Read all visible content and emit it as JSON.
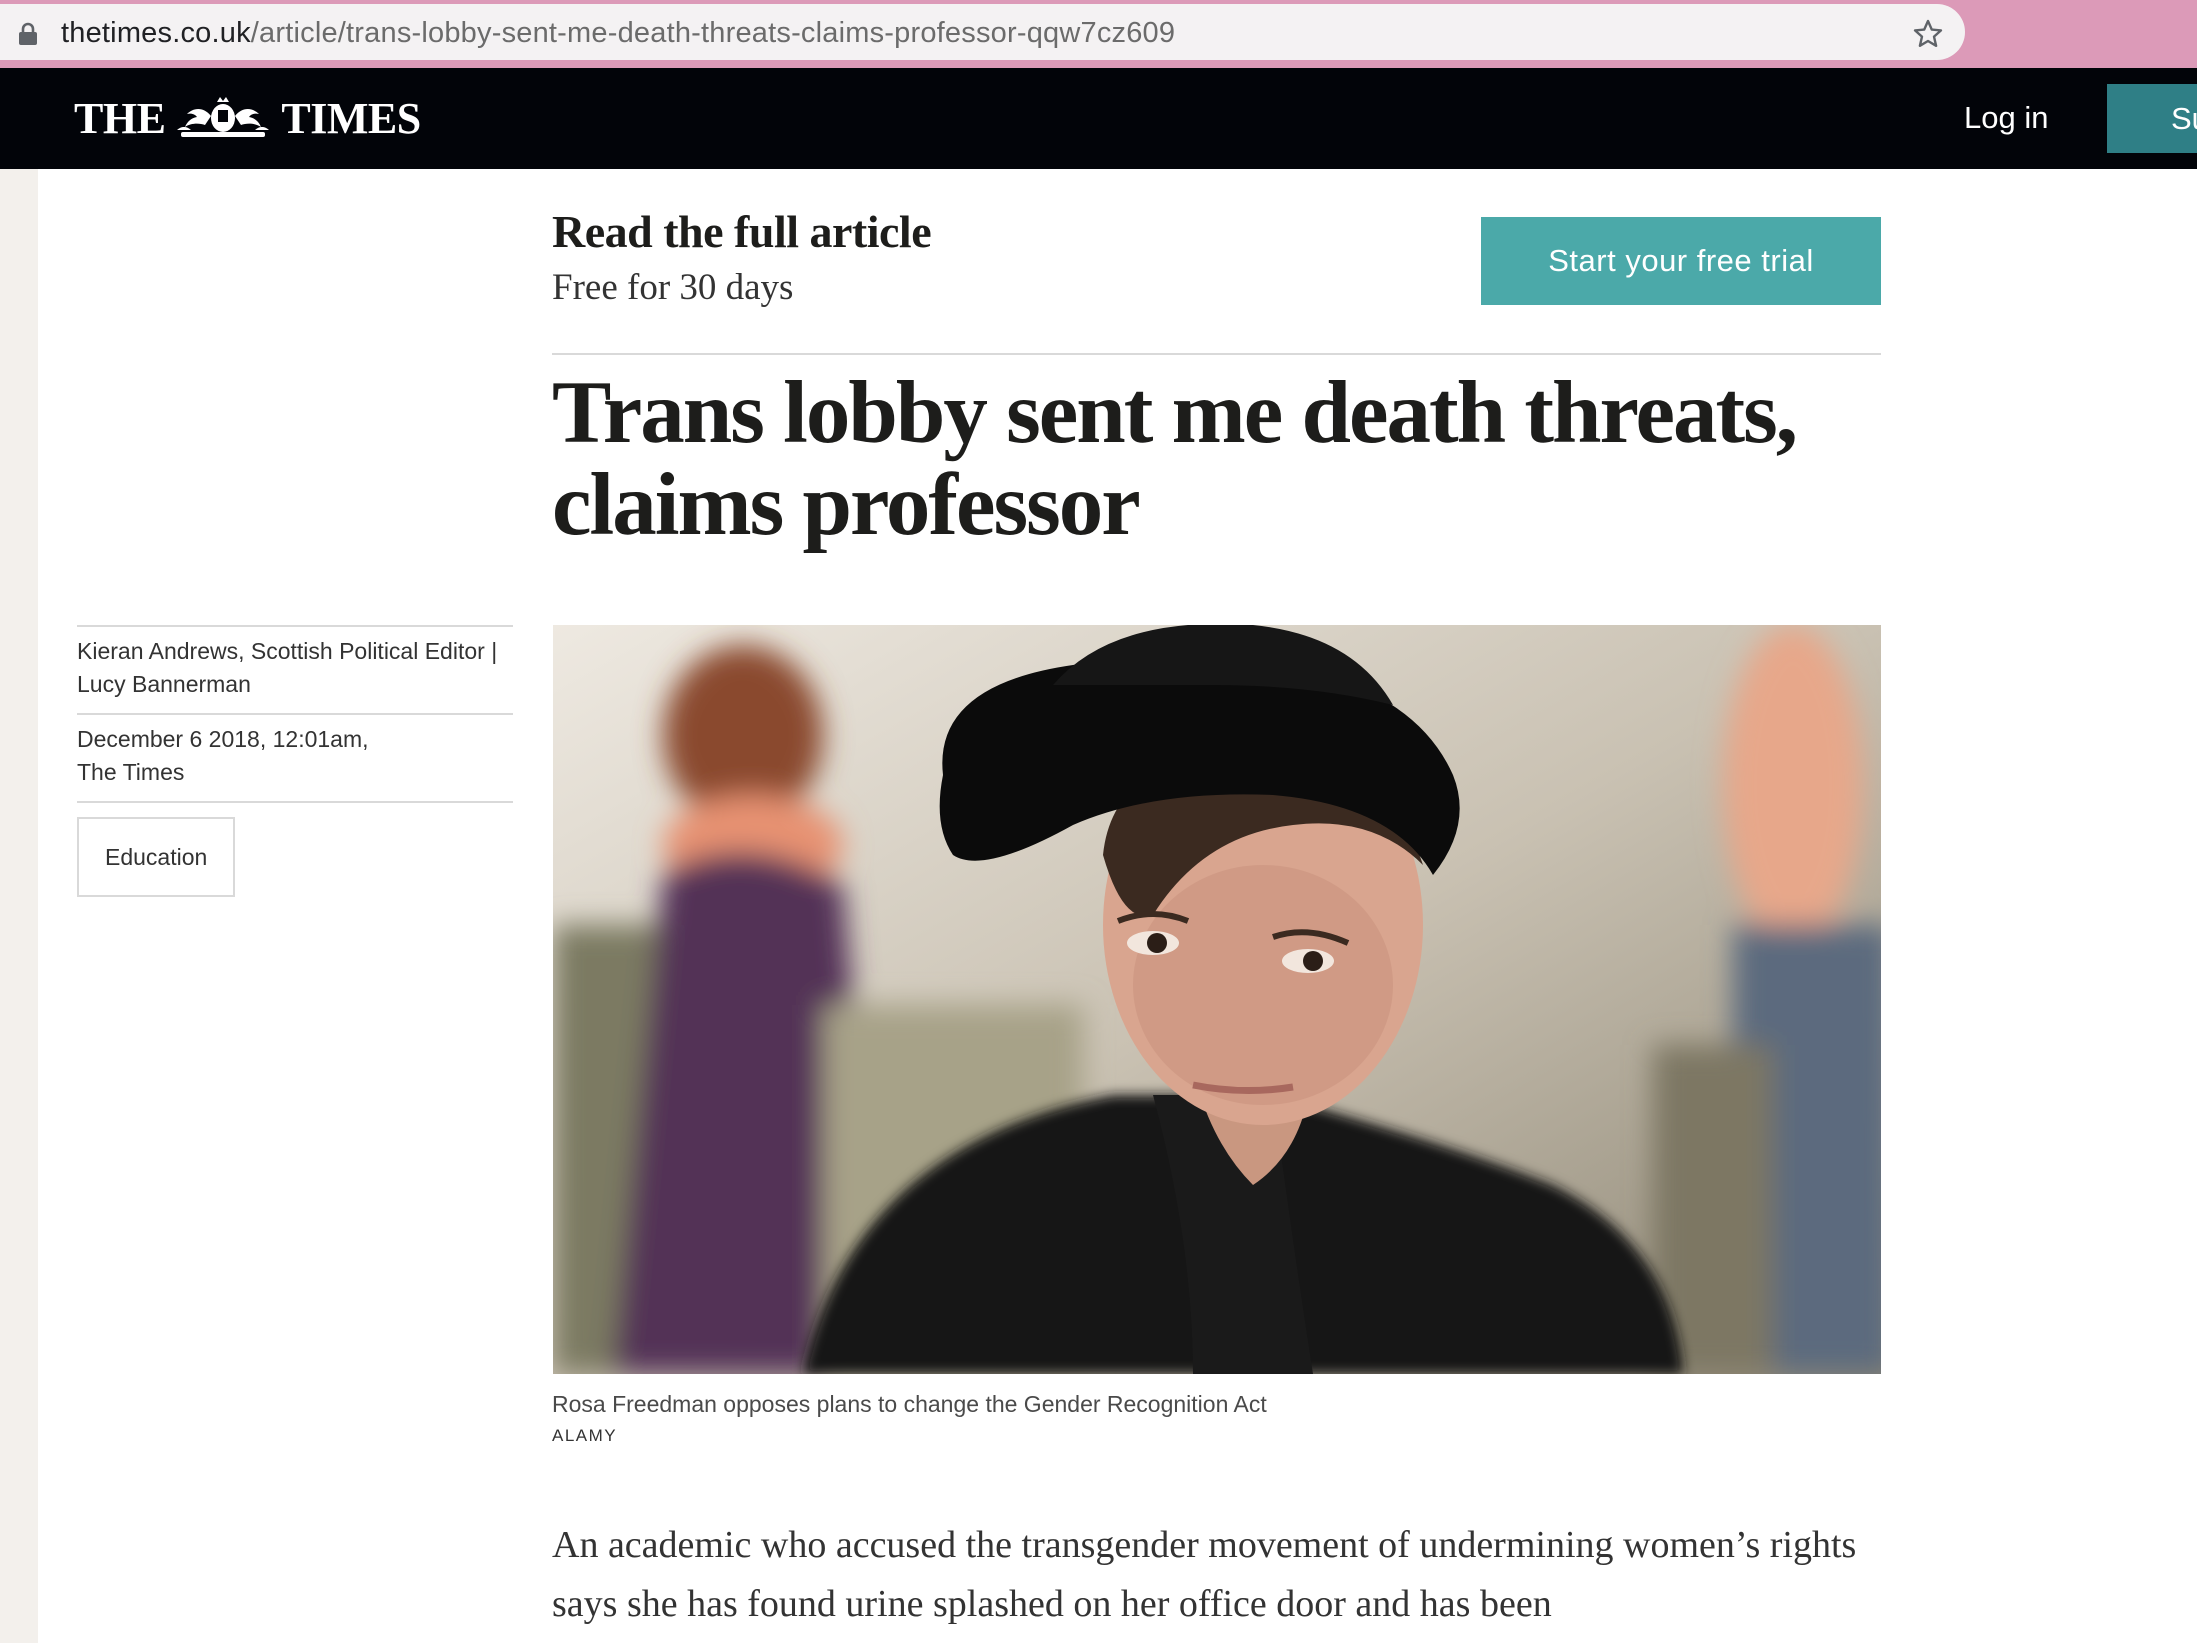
{
  "browser": {
    "url_domain": "thetimes.co.uk",
    "url_path": "/article/trans-lobby-sent-me-death-threats-claims-professor-qqw7cz609",
    "icons": [
      "lock-icon",
      "star-icon"
    ]
  },
  "header": {
    "masthead_left": "THE",
    "masthead_right": "TIMES",
    "login_label": "Log in",
    "subscribe_label": "Su"
  },
  "promo": {
    "title": "Read the full article",
    "subtitle": "Free for 30 days",
    "cta_label": "Start your free trial"
  },
  "article": {
    "headline": "Trans lobby sent me death threats, claims professor",
    "authors": "Kieran Andrews, Scottish Political Editor | Lucy Bannerman",
    "date_line": "December 6 2018, 12:01am,",
    "publication": "The Times",
    "tag": "Education",
    "caption": "Rosa Freedman opposes plans to change the Gender Recognition Act",
    "credit": "ALAMY",
    "body": "An academic who accused the transgender movement of undermining women’s rights says she has found urine splashed on her office door and has been"
  },
  "colors": {
    "browser_bar": "#dc9ab8",
    "header_bg": "#020409",
    "cta_teal": "#4ba9a9",
    "subscribe_teal": "#2f7f86"
  }
}
